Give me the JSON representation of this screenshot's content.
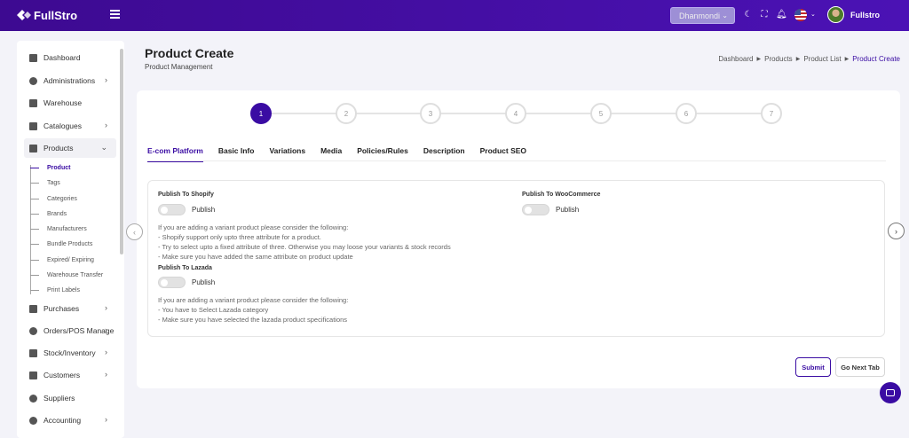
{
  "brand": {
    "name": "FullStro"
  },
  "topbar": {
    "store_select": "Dhanmondi",
    "user_name": "Fullstro"
  },
  "sidebar": {
    "items": [
      {
        "label": "Dashboard",
        "has_arrow": false
      },
      {
        "label": "Administrations",
        "has_arrow": true
      },
      {
        "label": "Warehouse",
        "has_arrow": false
      },
      {
        "label": "Catalogues",
        "has_arrow": true
      },
      {
        "label": "Products",
        "has_arrow": true,
        "expanded": true
      },
      {
        "label": "Purchases",
        "has_arrow": true
      },
      {
        "label": "Orders/POS Manage",
        "has_arrow": true
      },
      {
        "label": "Stock/Inventory",
        "has_arrow": true
      },
      {
        "label": "Customers",
        "has_arrow": true
      },
      {
        "label": "Suppliers",
        "has_arrow": false
      },
      {
        "label": "Accounting",
        "has_arrow": true
      }
    ],
    "product_sub_items": [
      "Product",
      "Tags",
      "Categories",
      "Brands",
      "Manufacturers",
      "Bundle Products",
      "Expired/ Expiring",
      "Warehouse Transfer",
      "Print Labels"
    ]
  },
  "header": {
    "title": "Product Create",
    "subtitle": "Product Management",
    "breadcrumb": [
      "Dashboard",
      "Products",
      "Product List",
      "Product Create"
    ]
  },
  "steps": [
    "1",
    "2",
    "3",
    "4",
    "5",
    "6",
    "7"
  ],
  "tabs": [
    "E-com Platform",
    "Basic Info",
    "Variations",
    "Media",
    "Policies/Rules",
    "Description",
    "Product SEO"
  ],
  "ecom": {
    "shopify_label": "Publish To Shopify",
    "woocommerce_label": "Publish To WooCommerce",
    "lazada_label": "Publish To Lazada",
    "toggle_text": "Publish",
    "shopify_notes": [
      "If you are adding a variant product please consider the following:",
      "- Shopify support only upto three attribute for a product.",
      "- Try to select upto a fixed attribute of three. Otherwise you may loose your variants & stock records",
      "- Make sure you have added the same attribute on product update"
    ],
    "lazada_notes": [
      "If you are adding a variant product please consider the following:",
      "- You have to Select Lazada category",
      "- Make sure you have selected the lazada product specifications"
    ]
  },
  "buttons": {
    "submit": "Submit",
    "next": "Go Next Tab"
  }
}
